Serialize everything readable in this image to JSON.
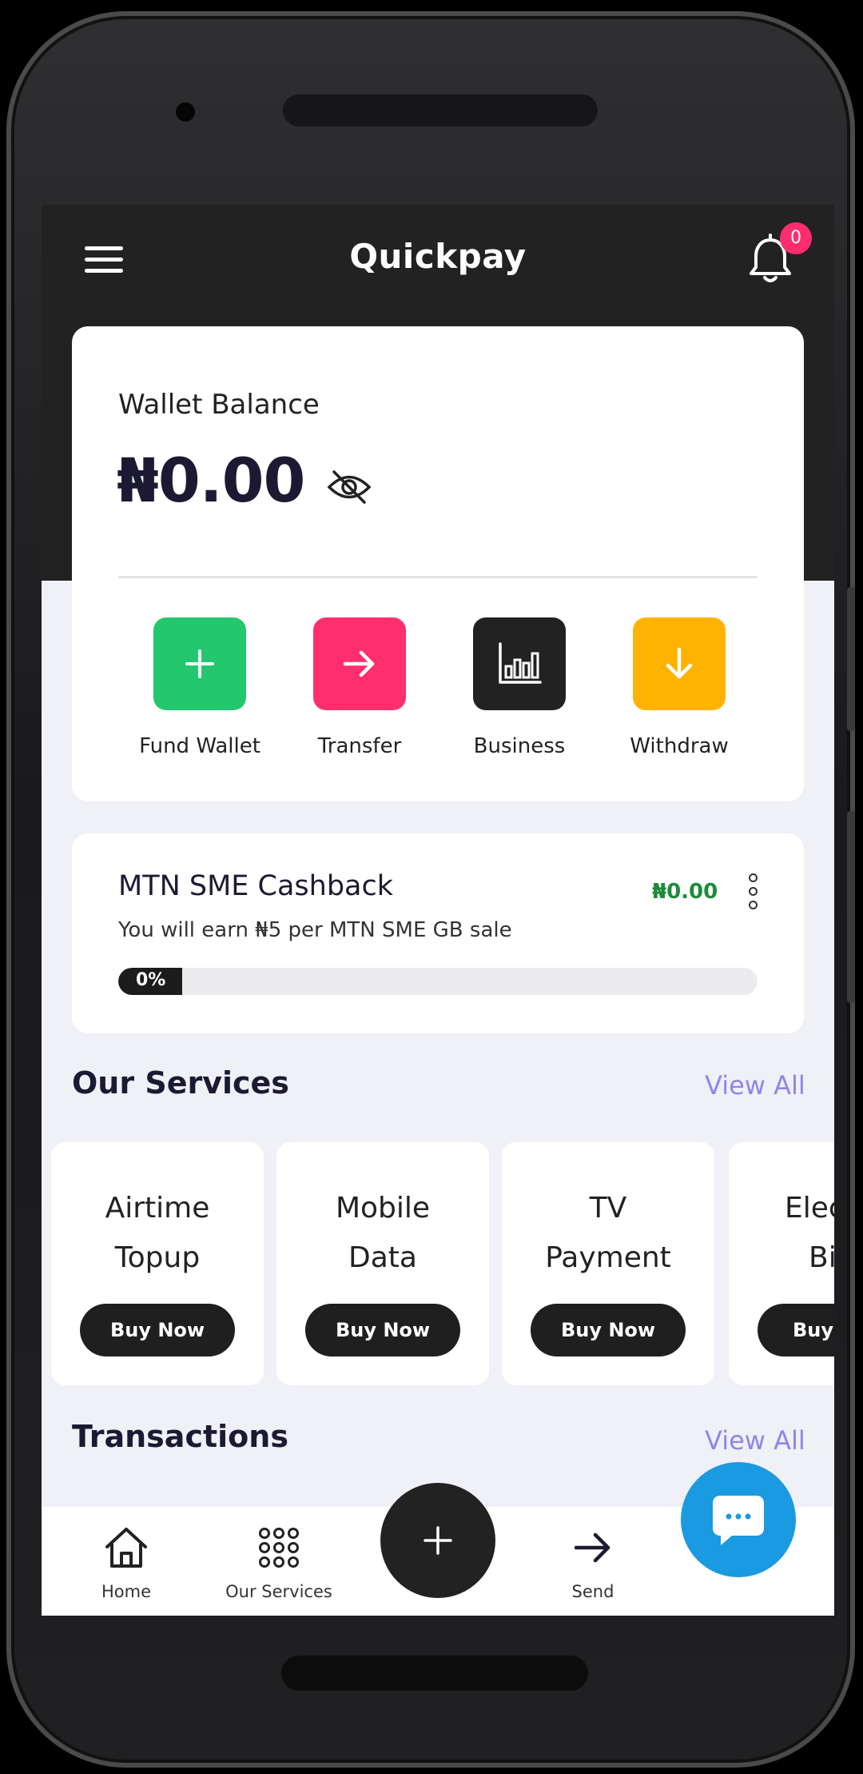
{
  "header": {
    "title": "Quickpay",
    "notification_count": "0"
  },
  "wallet": {
    "label": "Wallet Balance",
    "amount": "₦0.00",
    "actions": [
      {
        "label": "Fund Wallet",
        "icon": "plus-icon",
        "color": "#22c76e"
      },
      {
        "label": "Transfer",
        "icon": "arrow-right-icon",
        "color": "#ff2e6d"
      },
      {
        "label": "Business",
        "icon": "bar-chart-icon",
        "color": "#222222"
      },
      {
        "label": "Withdraw",
        "icon": "arrow-down-icon",
        "color": "#ffb300"
      }
    ]
  },
  "cashback": {
    "title": "MTN SME Cashback",
    "subtitle": "You will earn ₦5 per MTN SME GB sale",
    "amount": "₦0.00",
    "progress_label": "0%",
    "progress_value": 0
  },
  "services": {
    "title": "Our Services",
    "view_all": "View All",
    "items": [
      {
        "line1": "Airtime",
        "line2": "Topup",
        "button": "Buy Now"
      },
      {
        "line1": "Mobile",
        "line2": "Data",
        "button": "Buy Now"
      },
      {
        "line1": "TV",
        "line2": "Payment",
        "button": "Buy Now"
      },
      {
        "line1": "Elec",
        "line2": "Bi",
        "button": "Buy"
      }
    ]
  },
  "transactions": {
    "title": "Transactions",
    "view_all": "View All"
  },
  "bottom_nav": {
    "items": [
      {
        "label": "Home",
        "icon": "home-icon"
      },
      {
        "label": "Our Services",
        "icon": "grid-icon"
      },
      {
        "label": "Send",
        "icon": "arrow-right-icon"
      }
    ]
  },
  "colors": {
    "appbar": "#222222",
    "accent_view_all": "#8f86e8",
    "cashback_green": "#1e8a3a",
    "chat": "#1a9ae0"
  }
}
